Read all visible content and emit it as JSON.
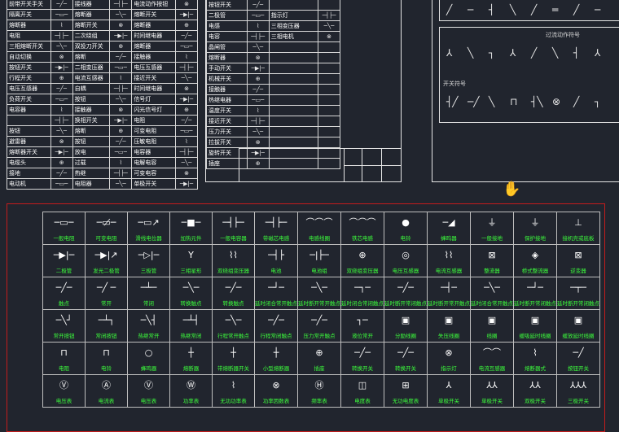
{
  "left_table": {
    "col1": [
      "前带开关手关",
      "隔离开关",
      "熔断器",
      "电阻",
      "三相熔断开关",
      "自动切换",
      "按钮开关",
      "行程开关",
      "电压互感器",
      "负荷开关",
      "电容器",
      "",
      "按钮",
      "避雷器",
      "熔断器开关",
      "电缆头",
      "接地",
      "电动机"
    ],
    "col2": [
      "接线器",
      "熔断器",
      "熔断开关",
      "二次绕组",
      "双投刀开关",
      "熔断",
      "二相变压器",
      "电流互感器",
      "自耦",
      "按钮",
      "接触器",
      "换相开关",
      "熔断",
      "按钮",
      "放电",
      "过载",
      "热继",
      "电阻器"
    ],
    "col3": [
      "电流动作按钮",
      "熔断开关",
      "熔断器",
      "时间继电器",
      "熔断器",
      "接触器",
      "电压互感器",
      "接近开关",
      "时间继电器",
      "信号灯",
      "闪光信号灯",
      "电阻",
      "可变电阻",
      "压敏电阻",
      "电容器",
      "电解电容",
      "可变电容",
      "单极开关"
    ]
  },
  "mid_table": {
    "col1": [
      "按钮开关",
      "二极管",
      "电感",
      "电容",
      "晶闸管",
      "熔断器",
      "手动开关",
      "机械开关",
      "接触器",
      "热继电器",
      "温度开关",
      "接近开关",
      "压力开关",
      "拉拔开关",
      "旋转开关",
      "插座"
    ],
    "col2": [
      "",
      "指示灯",
      "三相变压器",
      "三相电机",
      "",
      "",
      "",
      "",
      "",
      "",
      "",
      "",
      "",
      "",
      "",
      ""
    ]
  },
  "top_right": {
    "panel1_title": "过流动作符号",
    "panel2_title": "开关符号"
  },
  "library": {
    "rows": [
      [
        {
          "g": "─▭─",
          "c": "一般电阻"
        },
        {
          "g": "─▭̸─",
          "c": "可变电阻"
        },
        {
          "g": "─▭↗",
          "c": "滑线电位器"
        },
        {
          "g": "─■─",
          "c": "加热元件"
        },
        {
          "g": "─┤├─",
          "c": "一般电容器"
        },
        {
          "g": "─┤├─",
          "c": "带磁芯电感"
        },
        {
          "g": "⌒⌒⌒",
          "c": "电感线圈"
        },
        {
          "g": "⌒⌒⌒",
          "c": "铁芯电感"
        },
        {
          "g": "●",
          "c": "电铃"
        },
        {
          "g": "─◢",
          "c": "蜂鸣器"
        },
        {
          "g": "⏚",
          "c": "一般接地"
        },
        {
          "g": "⏚",
          "c": "保护接地"
        },
        {
          "g": "⊥",
          "c": "接机壳或底板"
        }
      ],
      [
        {
          "g": "─▶|─",
          "c": "二极管"
        },
        {
          "g": "─▶|↗",
          "c": "发光二极管"
        },
        {
          "g": "─▷|─",
          "c": "三极管"
        },
        {
          "g": "Y",
          "c": "三相星形"
        },
        {
          "g": "⌇⌇",
          "c": "双绕组变压器"
        },
        {
          "g": "─┤├",
          "c": "电池"
        },
        {
          "g": "─|├─",
          "c": "电池组"
        },
        {
          "g": "⊕",
          "c": "双绕组变压器"
        },
        {
          "g": "◎",
          "c": "电压互感器"
        },
        {
          "g": "⌇⌇",
          "c": "电流互感器"
        },
        {
          "g": "⊠",
          "c": "整流器"
        },
        {
          "g": "◈",
          "c": "桥式整流器"
        },
        {
          "g": "⊠",
          "c": "逆变器"
        }
      ],
      [
        {
          "g": "─╱─",
          "c": "触点"
        },
        {
          "g": "─╱ ─",
          "c": "常开"
        },
        {
          "g": "─┴─",
          "c": "常闭"
        },
        {
          "g": "─╲─",
          "c": "转换触点"
        },
        {
          "g": "─╱─",
          "c": "转换触点"
        },
        {
          "g": "─┘─",
          "c": "延时闭合常开触点"
        },
        {
          "g": "─╲─",
          "c": "延时断开常开触点"
        },
        {
          "g": "─┐─",
          "c": "延时闭合常闭触点"
        },
        {
          "g": "─╱─",
          "c": "延时断开常闭触点"
        },
        {
          "g": "─┤─",
          "c": "延时断开常开触点"
        },
        {
          "g": "─╲─",
          "c": "延时闭合常开触点"
        },
        {
          "g": "─┘─",
          "c": "延时断开常闭触点"
        },
        {
          "g": "─┬─",
          "c": "延时断开常闭触点"
        }
      ],
      [
        {
          "g": "─╲┘",
          "c": "常开按钮"
        },
        {
          "g": "─┴┐",
          "c": "常闭按钮"
        },
        {
          "g": "─╲┤",
          "c": "热继常开"
        },
        {
          "g": "─┴┤",
          "c": "热继常闭"
        },
        {
          "g": "─╲─",
          "c": "行程常开触点"
        },
        {
          "g": "─╱─",
          "c": "行程常闭触点"
        },
        {
          "g": "─╱─",
          "c": "压力常开触点"
        },
        {
          "g": "┐─",
          "c": "液位常开"
        },
        {
          "g": "▣",
          "c": "分励线圈"
        },
        {
          "g": "▣",
          "c": "失压线圈"
        },
        {
          "g": "▣",
          "c": "线圈"
        },
        {
          "g": "▣",
          "c": "缓吸延时线圈"
        },
        {
          "g": "▣",
          "c": "缓放延时线圈"
        }
      ],
      [
        {
          "g": "⊓",
          "c": "电阻"
        },
        {
          "g": "⊓",
          "c": "电铃"
        },
        {
          "g": "○",
          "c": "蜂鸣器"
        },
        {
          "g": "┼",
          "c": "熔断器"
        },
        {
          "g": "┼",
          "c": "带熔断器开关"
        },
        {
          "g": "┼",
          "c": "小型熔断器"
        },
        {
          "g": "⊕",
          "c": "插座"
        },
        {
          "g": "─╱─",
          "c": "转换开关"
        },
        {
          "g": "─╱─",
          "c": "转换开关"
        },
        {
          "g": "⊗",
          "c": "指示灯"
        },
        {
          "g": "⌒⌒",
          "c": "电流互感器"
        },
        {
          "g": "⌇",
          "c": "熔断器式"
        },
        {
          "g": "─╱",
          "c": "按钮开关"
        }
      ],
      [
        {
          "g": "Ⓥ",
          "c": "电压表"
        },
        {
          "g": "Ⓐ",
          "c": "电流表"
        },
        {
          "g": "Ⓥ",
          "c": "电压表"
        },
        {
          "g": "Ⓦ",
          "c": "功率表"
        },
        {
          "g": "⌇",
          "c": "无功功率表"
        },
        {
          "g": "⊗",
          "c": "功率因数表"
        },
        {
          "g": "Ⓗ",
          "c": "频率表"
        },
        {
          "g": "◫",
          "c": "电度表"
        },
        {
          "g": "⊞",
          "c": "无功电度表"
        },
        {
          "g": "⅄",
          "c": "单极开关"
        },
        {
          "g": "⅄⅄",
          "c": "单极开关"
        },
        {
          "g": "⅄⅄",
          "c": "双极开关"
        },
        {
          "g": "⅄⅄⅄",
          "c": "三极开关"
        }
      ]
    ]
  },
  "cursor_icon": "hand-pointer-icon",
  "colors": {
    "background": "#21252e",
    "frame": "#c41c1c",
    "caption": "#3cff3c",
    "line": "#e6e6e6"
  }
}
